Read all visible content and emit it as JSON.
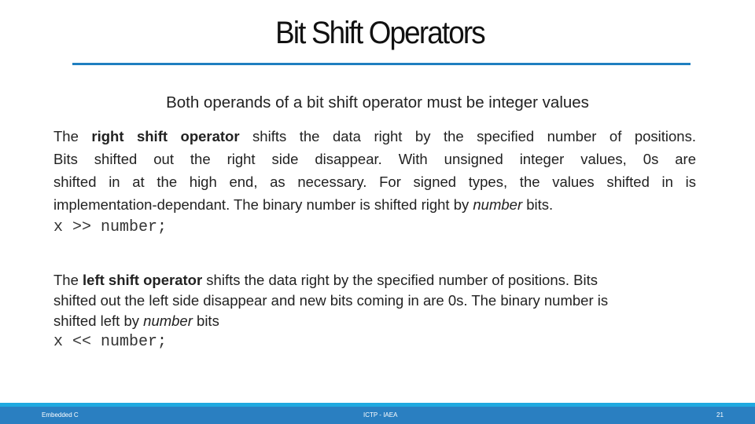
{
  "title": "Bit Shift Operators",
  "subtitle": "Both operands of a bit shift operator must be integer values",
  "right": {
    "pre": "The ",
    "bold": "right shift operator",
    "l1": " shifts the data right by the specified number of positions.",
    "l2": "Bits shifted out the  right side disappear. With unsigned integer values, 0s are",
    "l3": "shifted in at the high end, as necessary. For signed types, the values shifted in is",
    "l4a": "implementation-dependant. The binary number is  shifted right by ",
    "l4i": "number",
    "l4b": " bits.",
    "code": "x >> number;"
  },
  "left": {
    "pre": "The ",
    "bold": "left shift operator",
    "l1": " shifts the data right by the specified number of positions. Bits",
    "l2": "shifted out the left side disappear and new bits coming in are 0s. The binary number is",
    "l3a": "shifted left by ",
    "l3i": "number",
    "l3b": " bits",
    "code": "x << number;"
  },
  "footer": {
    "left": "Embedded C",
    "center": "ICTP - IAEA",
    "page": "21"
  },
  "colors": {
    "accent": "#1f7fc0",
    "footer": "#2a7fc1",
    "footer_light": "#1fa9e0"
  }
}
